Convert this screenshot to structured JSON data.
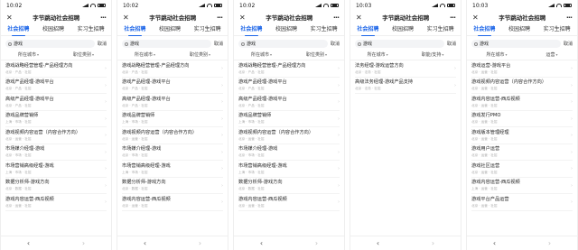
{
  "phones": [
    {
      "time": "10:02",
      "title": "字节跳动社会招聘",
      "tabs": [
        "社会招聘",
        "校园招聘",
        "实习生招聘"
      ],
      "search_value": "游戏",
      "cancel": "取消",
      "filters": [
        "所在城市",
        "职位类别"
      ],
      "items": [
        {
          "title": "游戏战略经营管理-产品经理方向",
          "meta": "北京 · 产品 · 社招"
        },
        {
          "title": "游戏产品经理-游戏平台",
          "meta": "北京 · 产品 · 社招"
        },
        {
          "title": "高级产品经理-游戏平台",
          "meta": "北京 · 产品 · 社招"
        },
        {
          "title": "游戏品牌营销师",
          "meta": "上海 · 市场 · 社招"
        },
        {
          "title": "游戏视频内容运营（内容合作方向）",
          "meta": "北京 · 运营 · 社招"
        },
        {
          "title": "市场媒介经理-游戏",
          "meta": "北京 · 市场 · 社招"
        },
        {
          "title": "市场营销高级经理-游戏",
          "meta": "上海 · 市场 · 社招"
        },
        {
          "title": "数据分析师-游戏方向",
          "meta": "北京 · 数据 · 社招"
        },
        {
          "title": "游戏内容运营-西瓜视频",
          "meta": "北京 · 运营 · 社招"
        }
      ]
    },
    {
      "time": "10:02",
      "title": "字节跳动社会招聘",
      "tabs": [
        "社会招聘",
        "校园招聘",
        "实习生招聘"
      ],
      "search_value": "游戏",
      "cancel": "取消",
      "filters": [
        "所在城市",
        "职位类别"
      ],
      "items": [
        {
          "title": "游戏战略经营管理-产品经理方向",
          "meta": "北京 · 产品 · 社招"
        },
        {
          "title": "游戏产品经理-游戏平台",
          "meta": "北京 · 产品 · 社招"
        },
        {
          "title": "高级产品经理-游戏平台",
          "meta": "北京 · 产品 · 社招"
        },
        {
          "title": "游戏品牌营销师",
          "meta": "上海 · 市场 · 社招"
        },
        {
          "title": "游戏视频内容运营（内容合作方向）",
          "meta": "北京 · 运营 · 社招"
        },
        {
          "title": "市场媒介经理-游戏",
          "meta": "北京 · 市场 · 社招"
        },
        {
          "title": "市场营销高级经理-游戏",
          "meta": "上海 · 市场 · 社招"
        },
        {
          "title": "数据分析师-游戏方向",
          "meta": "北京 · 数据 · 社招"
        },
        {
          "title": "游戏内容运营-西瓜视频",
          "meta": "北京 · 运营 · 社招"
        }
      ]
    },
    {
      "time": "10:02",
      "title": "字节跳动社会招聘",
      "tabs": [
        "社会招聘",
        "校园招聘",
        "实习生招聘"
      ],
      "search_value": "游戏",
      "cancel": "取消",
      "filters": [
        "所在城市",
        "职位类别"
      ],
      "items": [
        {
          "title": "游戏战略经营管理-产品经理方向",
          "meta": "北京 · 产品 · 社招"
        },
        {
          "title": "游戏产品经理-游戏平台",
          "meta": "北京 · 产品 · 社招"
        },
        {
          "title": "高级产品经理-游戏平台",
          "meta": "北京 · 产品 · 社招"
        },
        {
          "title": "游戏品牌营销师",
          "meta": "上海 · 市场 · 社招"
        },
        {
          "title": "游戏视频内容运营（内容合作方向）",
          "meta": "北京 · 运营 · 社招"
        },
        {
          "title": "市场媒介经理-游戏",
          "meta": "北京 · 市场 · 社招"
        },
        {
          "title": "市场营销高级经理-游戏",
          "meta": "上海 · 市场 · 社招"
        },
        {
          "title": "数据分析师-游戏方向",
          "meta": "北京 · 数据 · 社招"
        },
        {
          "title": "游戏内容运营-西瓜视频",
          "meta": "北京 · 运营 · 社招"
        }
      ]
    },
    {
      "time": "10:03",
      "title": "字节跳动社会招聘",
      "tabs": [
        "社会招聘",
        "校园招聘",
        "实习生招聘"
      ],
      "search_value": "游戏",
      "cancel": "取消",
      "filters": [
        "所在城市",
        "职能/支持"
      ],
      "items": [
        {
          "title": "法务经理-游戏运营方向",
          "meta": "北京 · 法务 · 社招"
        },
        {
          "title": "高级法务经理-游戏产品支持",
          "meta": "北京 · 法务 · 社招"
        }
      ]
    },
    {
      "time": "10:03",
      "title": "字节跳动社会招聘",
      "tabs": [
        "社会招聘",
        "校园招聘",
        "实习生招聘"
      ],
      "search_value": "游戏",
      "cancel": "取消",
      "filters": [
        "所在城市",
        "运营"
      ],
      "items": [
        {
          "title": "游戏运营-游戏平台",
          "meta": "北京 · 运营 · 社招"
        },
        {
          "title": "游戏视频内容运营（内容合作方向）",
          "meta": "北京 · 运营 · 社招"
        },
        {
          "title": "游戏内容运营-西瓜视频",
          "meta": "北京 · 运营 · 社招"
        },
        {
          "title": "游戏发行PMO",
          "meta": "北京 · 运营 · 社招"
        },
        {
          "title": "游戏版本管理经理",
          "meta": "北京 · 运营 · 社招"
        },
        {
          "title": "游戏用户运营",
          "meta": "北京 · 运营 · 社招"
        },
        {
          "title": "游戏社区运营",
          "meta": "北京 · 运营 · 社招"
        },
        {
          "title": "游戏内容运营-西瓜视频",
          "meta": "上海 · 运营 · 社招"
        },
        {
          "title": "游戏平台产品运营",
          "meta": "北京 · 运营 · 社招"
        }
      ]
    }
  ],
  "nav": {
    "back": "‹",
    "forward": "›"
  },
  "colors": {
    "accent": "#1a64e8"
  }
}
